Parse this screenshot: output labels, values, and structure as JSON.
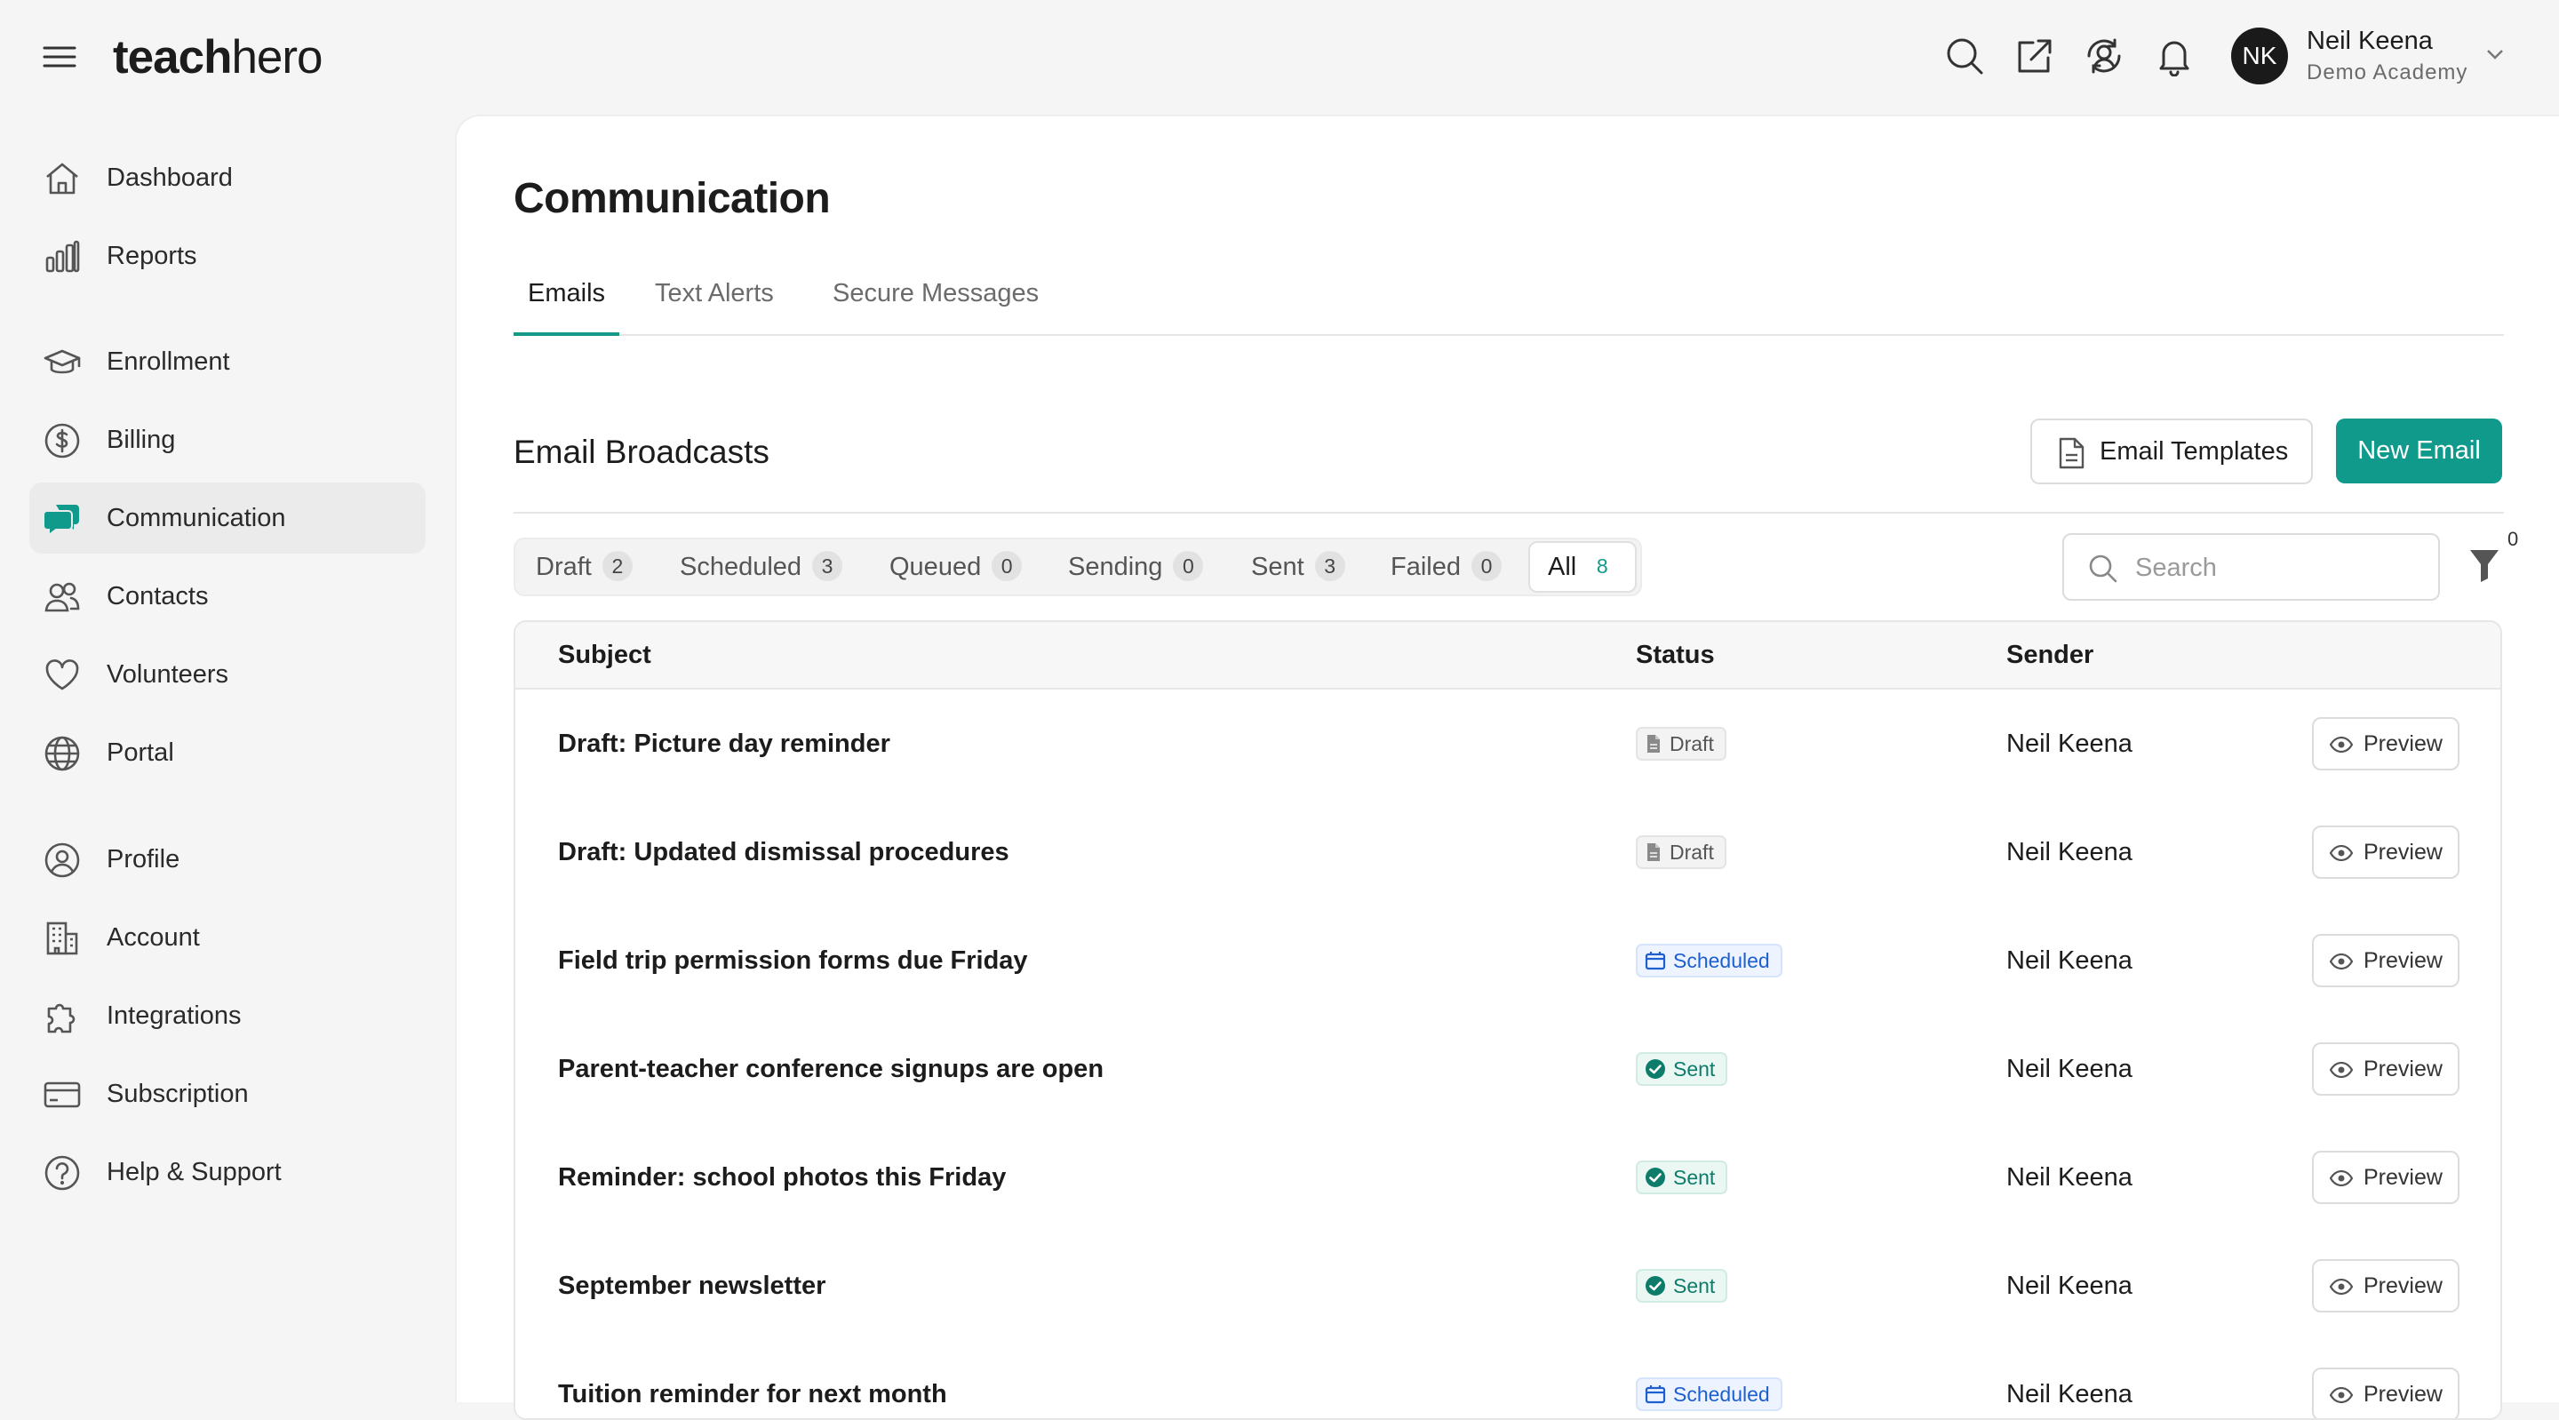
{
  "app": {
    "logo_bold": "teach",
    "logo_light": "hero"
  },
  "user": {
    "initials": "NK",
    "name": "Neil Keena",
    "org": "Demo Academy"
  },
  "sidebar": {
    "items": [
      {
        "label": "Dashboard",
        "icon": "home-icon",
        "active": false
      },
      {
        "label": "Reports",
        "icon": "bar-chart-icon",
        "active": false
      },
      {
        "label": "Enrollment",
        "icon": "graduation-cap-icon",
        "active": false
      },
      {
        "label": "Billing",
        "icon": "dollar-icon",
        "active": false
      },
      {
        "label": "Communication",
        "icon": "chat-bubbles-icon",
        "active": true
      },
      {
        "label": "Contacts",
        "icon": "users-icon",
        "active": false
      },
      {
        "label": "Volunteers",
        "icon": "heart-icon",
        "active": false
      },
      {
        "label": "Portal",
        "icon": "globe-icon",
        "active": false
      },
      {
        "label": "Profile",
        "icon": "user-circle-icon",
        "active": false
      },
      {
        "label": "Account",
        "icon": "building-icon",
        "active": false
      },
      {
        "label": "Integrations",
        "icon": "puzzle-icon",
        "active": false
      },
      {
        "label": "Subscription",
        "icon": "credit-card-icon",
        "active": false
      },
      {
        "label": "Help & Support",
        "icon": "help-circle-icon",
        "active": false
      }
    ]
  },
  "page": {
    "title": "Communication",
    "tabs": [
      {
        "label": "Emails",
        "active": true
      },
      {
        "label": "Text Alerts",
        "active": false
      },
      {
        "label": "Secure Messages",
        "active": false
      }
    ]
  },
  "broadcasts": {
    "title": "Email Broadcasts",
    "templates_label": "Email Templates",
    "new_label": "New Email",
    "filters": [
      {
        "label": "Draft",
        "count": "2",
        "active": false
      },
      {
        "label": "Scheduled",
        "count": "3",
        "active": false
      },
      {
        "label": "Queued",
        "count": "0",
        "active": false
      },
      {
        "label": "Sending",
        "count": "0",
        "active": false
      },
      {
        "label": "Sent",
        "count": "3",
        "active": false
      },
      {
        "label": "Failed",
        "count": "0",
        "active": false
      },
      {
        "label": "All",
        "count": "8",
        "active": true
      }
    ],
    "search_placeholder": "Search",
    "filter_count": "0",
    "columns": {
      "subject": "Subject",
      "status": "Status",
      "sender": "Sender"
    },
    "preview_label": "Preview",
    "rows": [
      {
        "subject": "Draft: Picture day reminder",
        "status": "Draft",
        "kind": "draft",
        "sender": "Neil Keena"
      },
      {
        "subject": "Draft: Updated dismissal procedures",
        "status": "Draft",
        "kind": "draft",
        "sender": "Neil Keena"
      },
      {
        "subject": "Field trip permission forms due Friday",
        "status": "Scheduled",
        "kind": "scheduled",
        "sender": "Neil Keena"
      },
      {
        "subject": "Parent-teacher conference signups are open",
        "status": "Sent",
        "kind": "sent",
        "sender": "Neil Keena"
      },
      {
        "subject": "Reminder: school photos this Friday",
        "status": "Sent",
        "kind": "sent",
        "sender": "Neil Keena"
      },
      {
        "subject": "September newsletter",
        "status": "Sent",
        "kind": "sent",
        "sender": "Neil Keena"
      },
      {
        "subject": "Tuition reminder for next month",
        "status": "Scheduled",
        "kind": "scheduled",
        "sender": "Neil Keena"
      }
    ]
  },
  "colors": {
    "accent": "#0f9a8c",
    "scheduled": "#1d5fd0",
    "sent": "#0d7c6a"
  }
}
